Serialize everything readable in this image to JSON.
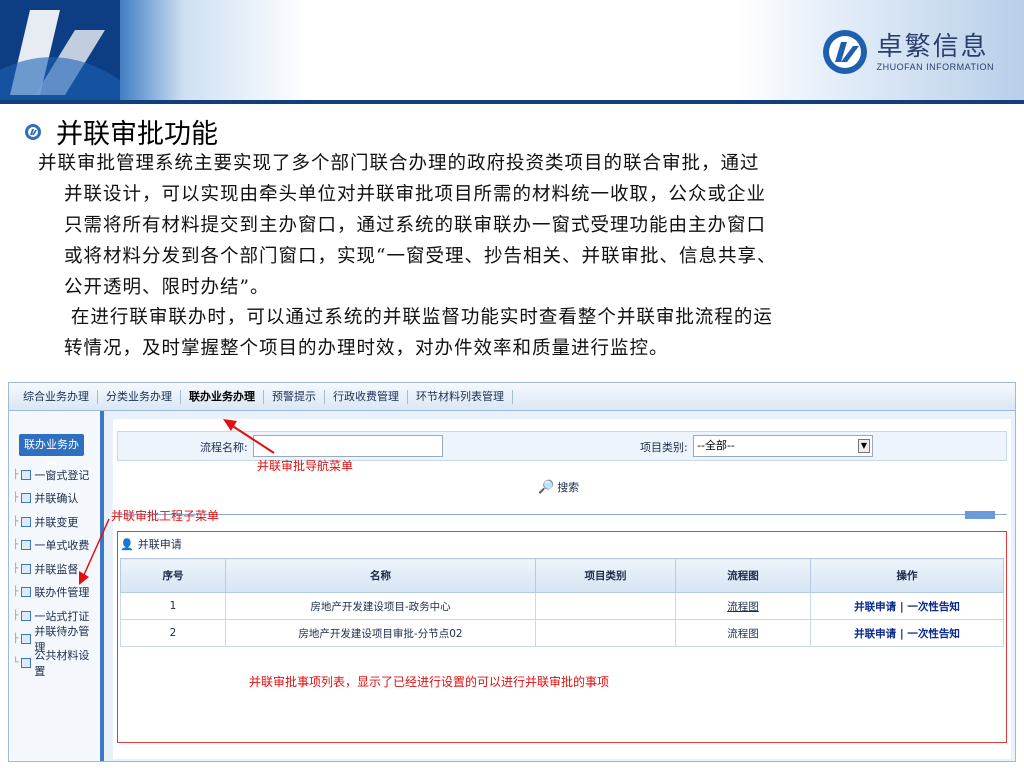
{
  "banner": {
    "brand_cn": "卓繁信息",
    "brand_en": "ZHUOFAN INFORMATION"
  },
  "slide": {
    "title": "并联审批功能",
    "para1_first": "并联审批管理系统主要实现了多个部门联合办理的政府投资类项目的联合审批，通过",
    "para1_lines": [
      "并联设计，可以实现由牵头单位对并联审批项目所需的材料统一收取，公众或企业",
      "只需将所有材料提交到主办窗口，通过系统的联审联办一窗式受理功能由主办窗口",
      "或将材料分发到各个部门窗口，实现“一窗受理、抄告相关、并联审批、信息共享、",
      "公开透明、限时办结”。"
    ],
    "para2_lines": [
      " 在进行联审联办时，可以通过系统的并联监督功能实时查看整个并联审批流程的运",
      "转情况，及时掌握整个项目的办理时效，对办件效率和质量进行监控。"
    ]
  },
  "app": {
    "nav": [
      "综合业务办理",
      "分类业务办理",
      "联办业务办理",
      "预警提示",
      "行政收费管理",
      "环节材料列表管理"
    ],
    "nav_active_index": 2,
    "sidebar_head": "联办业务办理",
    "sidebar_items": [
      "一窗式登记",
      "并联确认",
      "并联变更",
      "一单式收费",
      "并联监督",
      "联办件管理",
      "一站式打证",
      "并联待办管理",
      "公共材料设置"
    ],
    "form": {
      "flow_name_label": "流程名称:",
      "flow_name_value": "",
      "project_type_label": "项目类别:",
      "project_type_value": "--全部--",
      "search_label": "搜索"
    },
    "list": {
      "header": "并联申请",
      "columns": [
        "序号",
        "名称",
        "项目类别",
        "流程图",
        "操作"
      ],
      "rows": [
        {
          "no": "1",
          "name": "房地产开发建设项目-政务中心",
          "type": "",
          "flow": "流程图",
          "op": "并联申请 | 一次性告知"
        },
        {
          "no": "2",
          "name": "房地产开发建设项目审批-分节点02",
          "type": "",
          "flow": "流程图",
          "op": "并联申请 | 一次性告知"
        }
      ]
    }
  },
  "annotations": {
    "nav_menu": "并联审批导航菜单",
    "sub_menu": "并联审批工程子菜单",
    "list_desc": "并联审批事项列表，显示了已经进行设置的可以进行并联审批的事项"
  },
  "colors": {
    "accent": "#2f6fbf",
    "annotation": "#e01010"
  }
}
